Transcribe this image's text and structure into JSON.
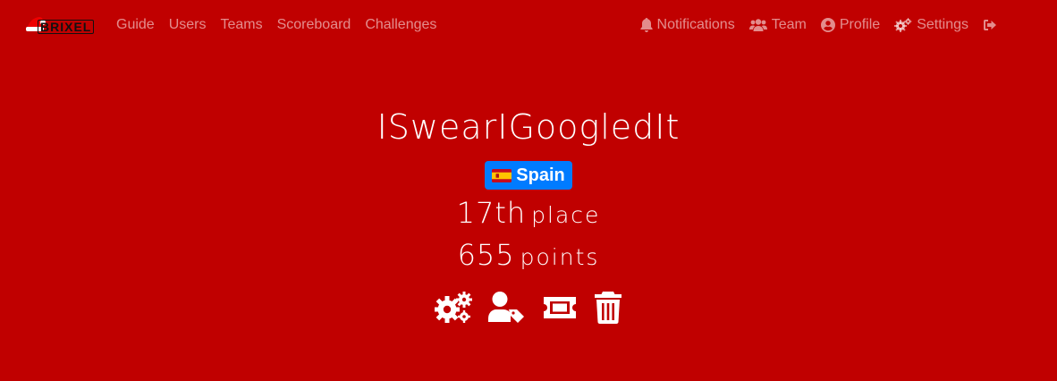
{
  "brand": {
    "logo_text": "BRIXEL"
  },
  "nav": {
    "left": [
      "Guide",
      "Users",
      "Teams",
      "Scoreboard",
      "Challenges"
    ],
    "right": {
      "notifications": "Notifications",
      "team": "Team",
      "profile": "Profile",
      "settings": "Settings"
    }
  },
  "team": {
    "name": "ISwearIGoogledIt",
    "country": "Spain",
    "place_value": "17th",
    "place_label": "place",
    "points_value": "655",
    "points_label": "points"
  },
  "actions": [
    "settings-icon",
    "user-tag-icon",
    "ticket-icon",
    "trash-icon"
  ],
  "colors": {
    "background": "#c00000",
    "badge": "#007bff"
  }
}
